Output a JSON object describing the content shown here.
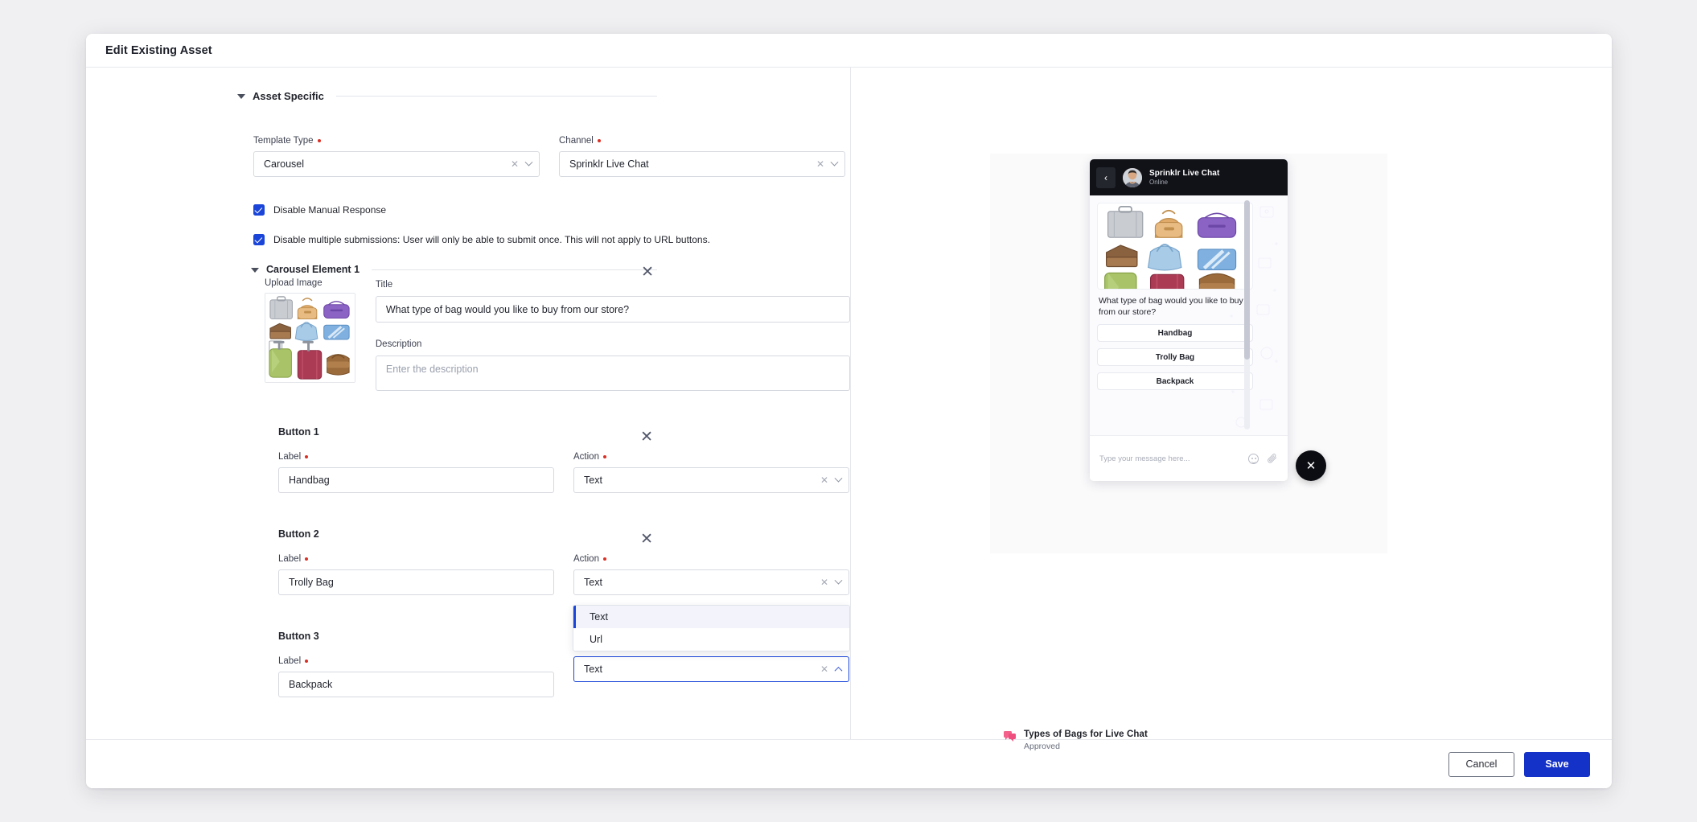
{
  "modal": {
    "title": "Edit Existing Asset"
  },
  "section": {
    "asset_specific_label": "Asset Specific"
  },
  "fields": {
    "template_type": {
      "label": "Template Type",
      "value": "Carousel",
      "required": true
    },
    "channel": {
      "label": "Channel",
      "value": "Sprinklr Live Chat",
      "required": true
    }
  },
  "checkboxes": [
    {
      "label": "Disable Manual Response",
      "checked": true
    },
    {
      "label": "Disable multiple submissions: User will only be able to submit once. This will not apply to URL buttons.",
      "checked": true
    }
  ],
  "carousel_element": {
    "title_label": "Carousel Element 1",
    "upload_label": "Upload Image",
    "title_field": {
      "label": "Title",
      "value": "What type of bag would you like to buy from our store?"
    },
    "description_field": {
      "label": "Description",
      "value": "",
      "placeholder": "Enter the description"
    }
  },
  "buttons": [
    {
      "title": "Button 1",
      "label_field": {
        "label": "Label",
        "value": "Handbag",
        "required": true
      },
      "action_field": {
        "label": "Action",
        "value": "Text",
        "required": true
      }
    },
    {
      "title": "Button 2",
      "label_field": {
        "label": "Label",
        "value": "Trolly Bag",
        "required": true
      },
      "action_field": {
        "label": "Action",
        "value": "Text",
        "required": true
      }
    },
    {
      "title": "Button 3",
      "label_field": {
        "label": "Label",
        "value": "Backpack",
        "required": true
      },
      "action_field": {
        "label": "Action",
        "value": "Text",
        "required": true
      }
    }
  ],
  "dropdown": {
    "open": true,
    "options": [
      {
        "label": "Text",
        "selected": true
      },
      {
        "label": "Url",
        "selected": false
      }
    ]
  },
  "preview": {
    "chat": {
      "name": "Sprinklr Live Chat",
      "status": "Online",
      "message": "What type of bag would you like to buy from our store?",
      "quick_replies": [
        "Handbag",
        "Trolly Bag",
        "Backpack"
      ],
      "input_placeholder": "Type your message here..."
    },
    "asset": {
      "name": "Types of Bags for Live Chat",
      "status": "Approved"
    }
  },
  "footer": {
    "cancel_label": "Cancel",
    "save_label": "Save"
  },
  "colors": {
    "accent": "#1431c8",
    "required": "#d93025",
    "chat_header": "#111218",
    "asset_icon": "#f4628c"
  }
}
